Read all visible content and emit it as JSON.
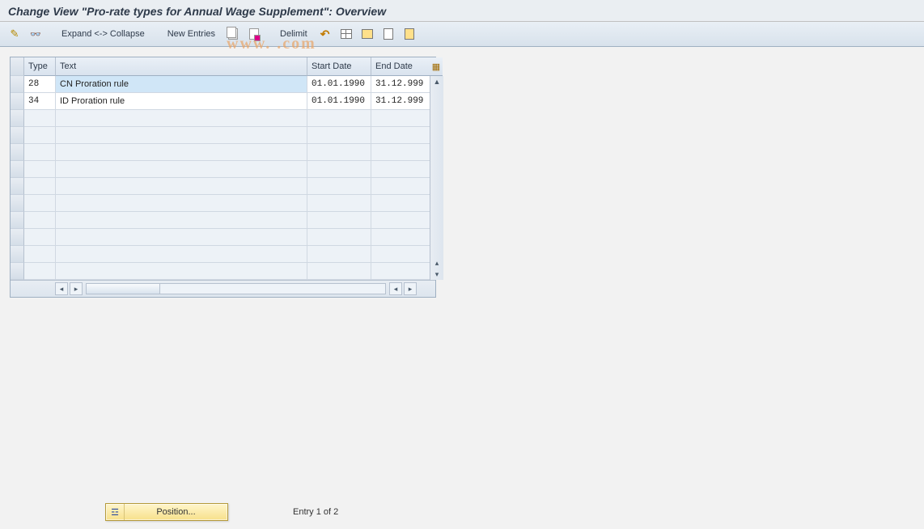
{
  "title": "Change View \"Pro-rate types for Annual Wage Supplement\": Overview",
  "toolbar": {
    "expand_collapse": "Expand <-> Collapse",
    "new_entries": "New Entries",
    "delimit": "Delimit"
  },
  "watermark": "www.                         .com",
  "table": {
    "headers": {
      "type": "Type",
      "text": "Text",
      "start_date": "Start Date",
      "end_date": "End Date"
    },
    "rows": [
      {
        "type": "28",
        "text": "CN Proration rule",
        "start": "01.01.1990",
        "end": "31.12.999"
      },
      {
        "type": "34",
        "text": "ID Proration rule",
        "start": "01.01.1990",
        "end": "31.12.999"
      }
    ],
    "empty_rows": 10
  },
  "footer": {
    "position_label": "Position...",
    "entry_status": "Entry 1 of 2"
  },
  "icons": {
    "pencil": "pencil-icon",
    "glasses": "glasses-icon"
  }
}
